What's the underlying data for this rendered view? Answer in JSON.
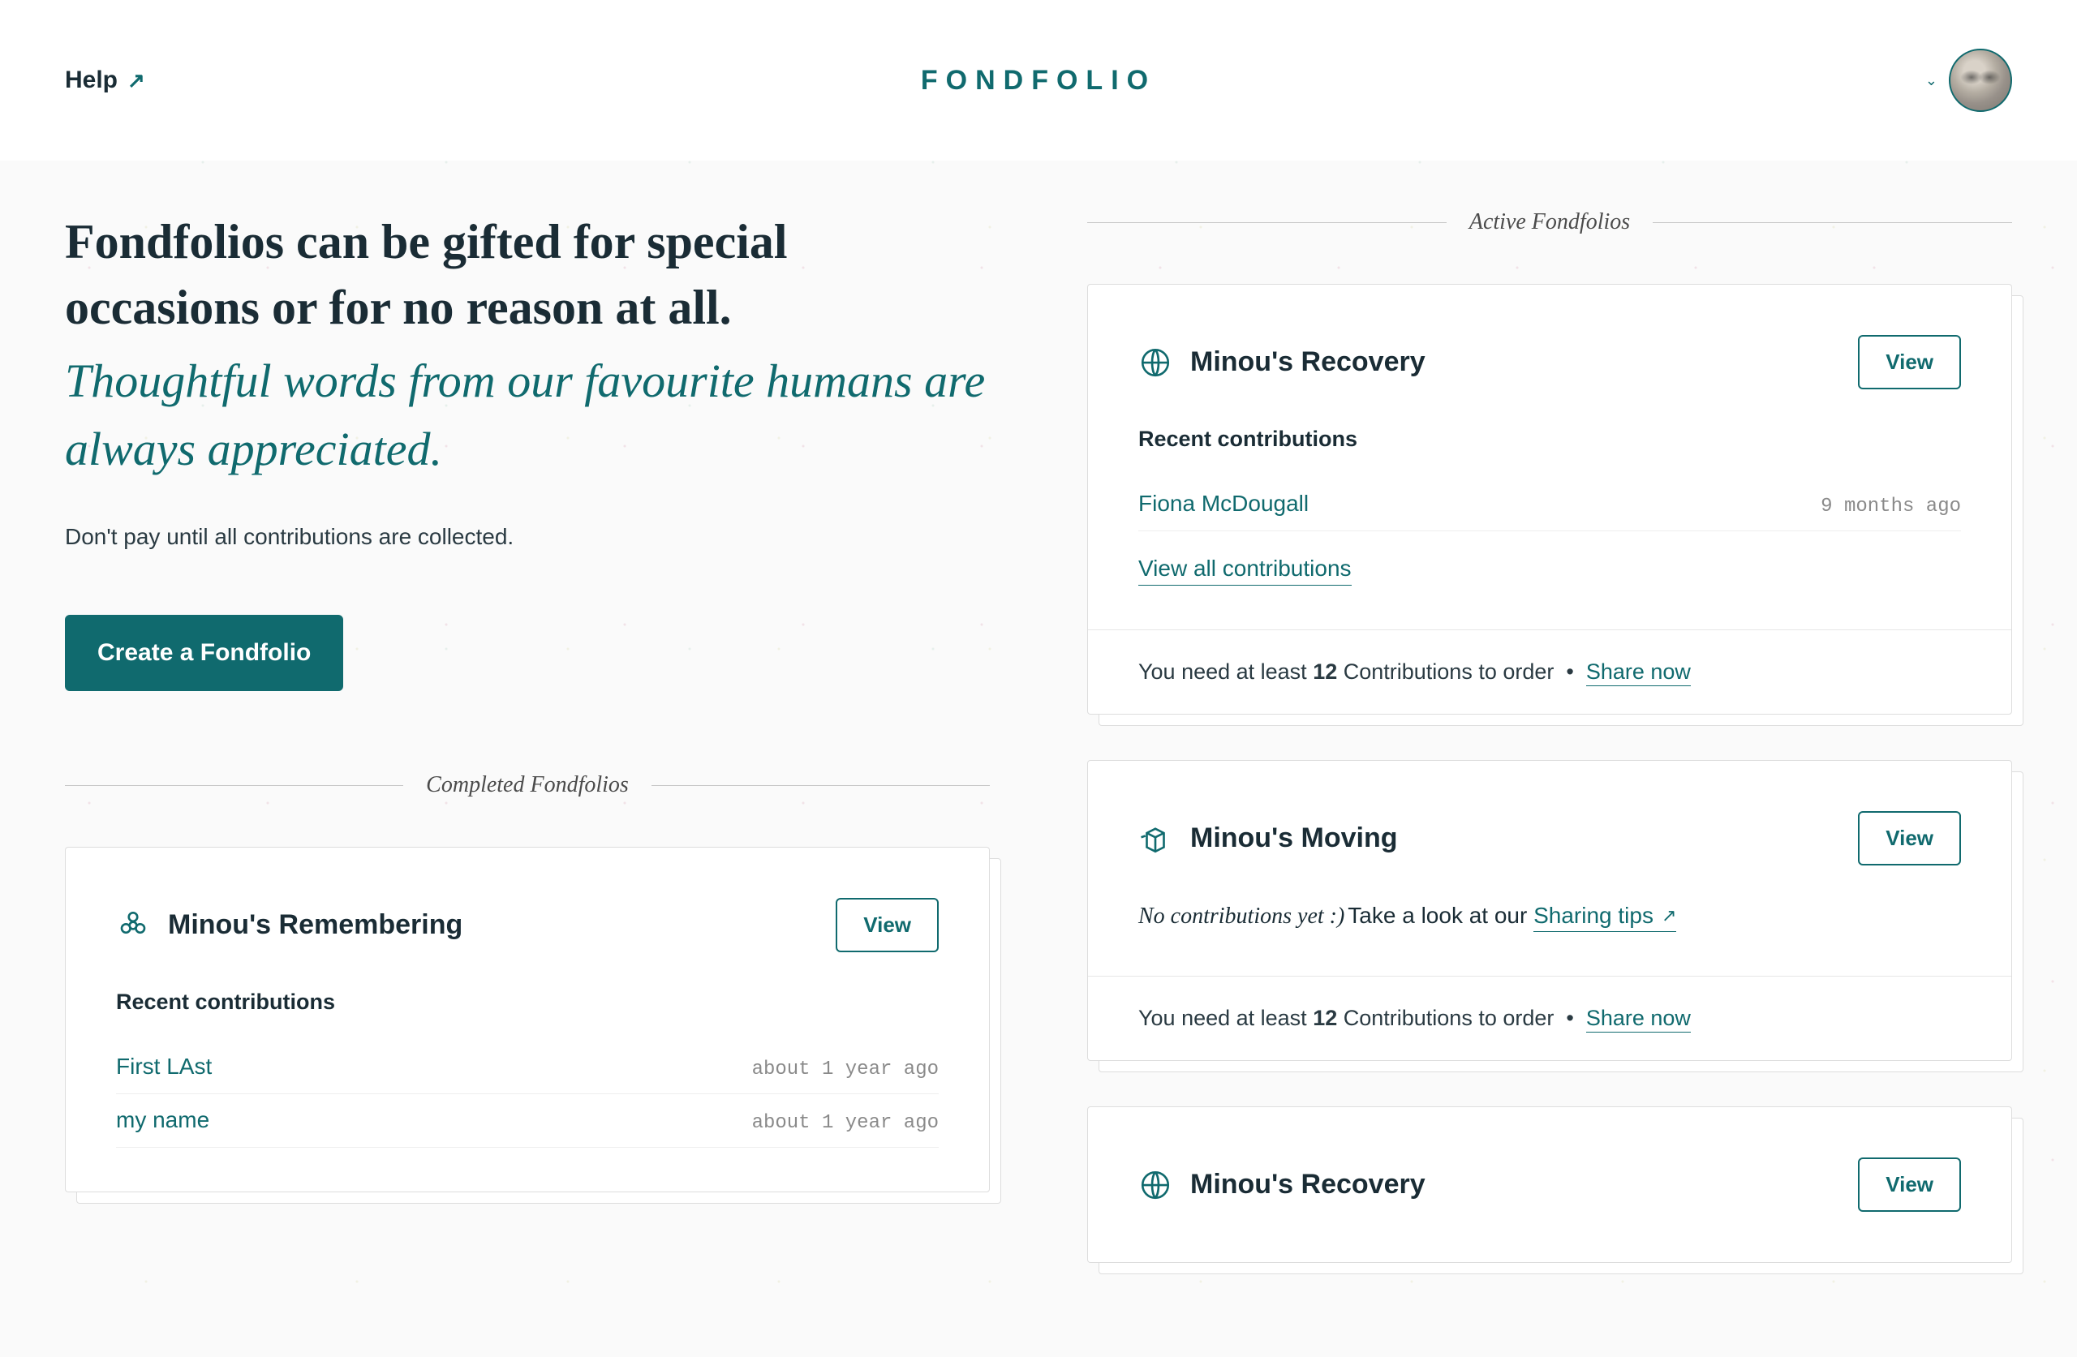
{
  "header": {
    "help_label": "Help",
    "logo_text": "FONDFOLIO"
  },
  "hero": {
    "title": "Fondfolios can be gifted for special occasions or for no reason at all.",
    "subtitle": "Thoughtful words from our favourite humans are always appreciated.",
    "note": "Don't pay until all contributions are collected.",
    "cta": "Create a Fondfolio"
  },
  "sections": {
    "completed_label": "Completed Fondfolios",
    "active_label": "Active Fondfolios"
  },
  "labels": {
    "view": "View",
    "recent": "Recent contributions",
    "view_all": "View all contributions",
    "need_prefix": "You need at least ",
    "need_count": "12",
    "need_suffix": " Contributions to order",
    "share_now": "Share now",
    "no_contrib": "No contributions yet :)",
    "take_look": "Take a look at our",
    "sharing_tips": "Sharing tips"
  },
  "completed": [
    {
      "title": "Minou's Remembering",
      "contributions": [
        {
          "name": "First LAst",
          "time": "about 1 year ago"
        },
        {
          "name": "my name",
          "time": "about 1 year ago"
        }
      ]
    }
  ],
  "active": [
    {
      "title": "Minou's Recovery",
      "icon": "globe",
      "contributions": [
        {
          "name": "Fiona McDougall",
          "time": "9 months ago"
        }
      ],
      "has_contributions": true
    },
    {
      "title": "Minou's Moving",
      "icon": "box",
      "has_contributions": false
    },
    {
      "title": "Minou's Recovery",
      "icon": "globe",
      "compact": true
    }
  ]
}
